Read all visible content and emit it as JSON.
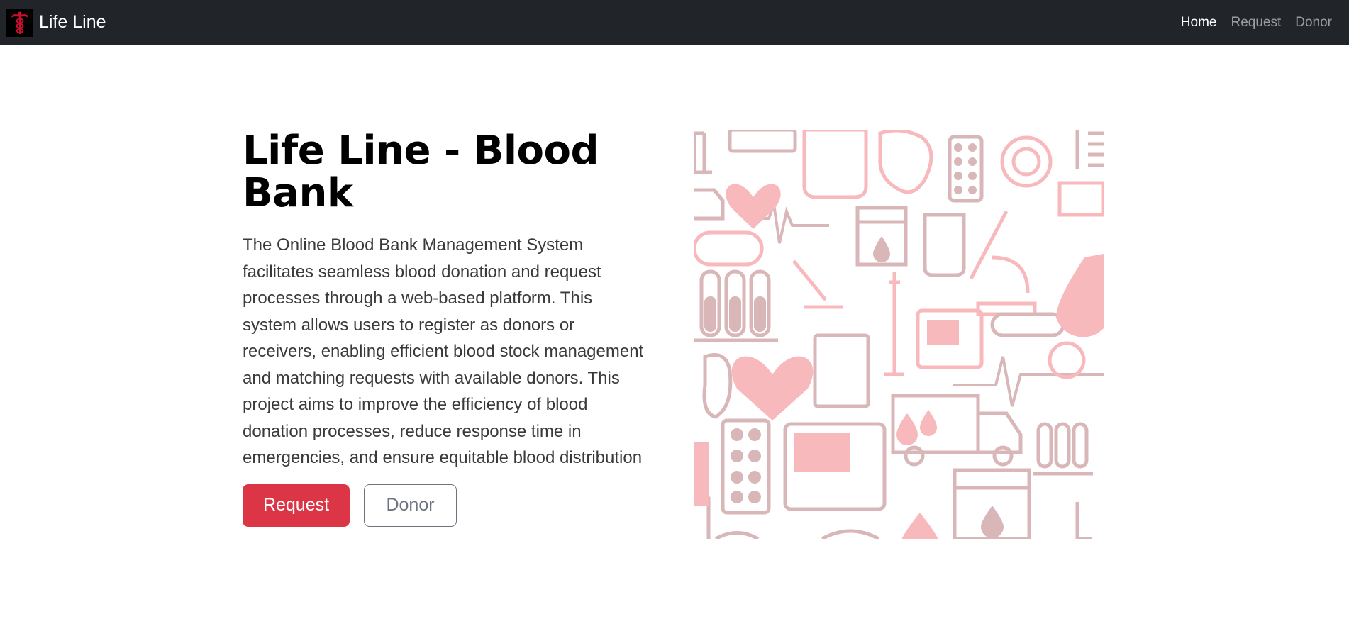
{
  "navbar": {
    "brand": "Life Line",
    "logo_icon": "caduceus-icon",
    "links": [
      {
        "label": "Home",
        "active": true
      },
      {
        "label": "Request",
        "active": false
      },
      {
        "label": "Donor",
        "active": false
      }
    ]
  },
  "hero": {
    "title": "Life Line - Blood Bank",
    "description": "The Online Blood Bank Management System facilitates seamless blood donation and request processes through a web-based platform. This system allows users to register as donors or receivers, enabling efficient blood stock management and matching requests with available donors. This project aims to improve the efficiency of blood donation processes, reduce response time in emergencies, and ensure equitable blood distribution",
    "buttons": {
      "request": "Request",
      "donor": "Donor"
    },
    "image": "medical-pattern-illustration"
  },
  "colors": {
    "navbar_bg": "#212529",
    "primary_red": "#dc3545",
    "outline_gray": "#6c757d",
    "illustration_pink": "#f8b9bd",
    "illustration_mauve": "#d9b7b9"
  }
}
